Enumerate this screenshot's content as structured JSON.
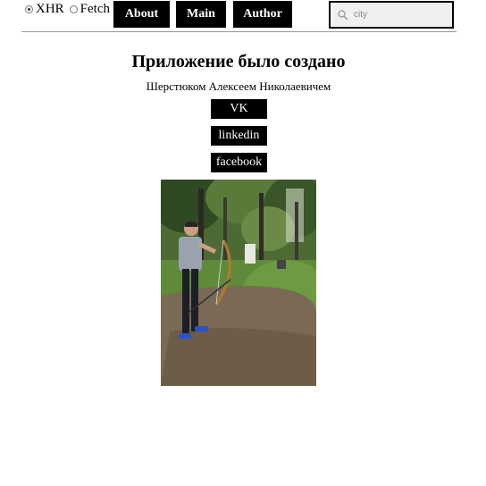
{
  "header": {
    "radios": [
      {
        "label": "XHR",
        "checked": true
      },
      {
        "label": "Fetch",
        "checked": false
      }
    ],
    "nav": [
      {
        "label": "About"
      },
      {
        "label": "Main"
      },
      {
        "label": "Author"
      }
    ],
    "search": {
      "placeholder": "city",
      "value": "",
      "icon": "search-icon"
    }
  },
  "main": {
    "title": "Приложение было создано",
    "subtitle": "Шерстюком Алексеем Николаевичем",
    "links": [
      {
        "label": "VK"
      },
      {
        "label": "linkedin"
      },
      {
        "label": "facebook"
      }
    ]
  },
  "colors": {
    "button_bg": "#000000",
    "button_text": "#ffffff",
    "search_bg": "#f0f0f0"
  }
}
